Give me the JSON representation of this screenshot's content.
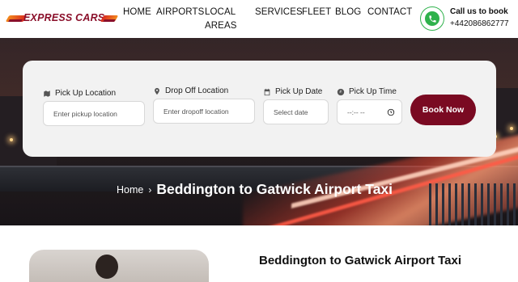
{
  "brand": {
    "logo_text": "EXPRESS CARS"
  },
  "nav": {
    "items": [
      "HOME",
      "AIRPORTS",
      "LOCAL AREAS",
      "SERVICES",
      "FLEET",
      "BLOG",
      "CONTACT"
    ]
  },
  "contact": {
    "call_label": "Call us to book",
    "phone": "+442086862777"
  },
  "booking": {
    "pickup_location": {
      "label": "Pick Up Location",
      "placeholder": "Enter pickup location"
    },
    "dropoff_location": {
      "label": "Drop Off Location",
      "placeholder": "Enter dropoff location"
    },
    "pickup_date": {
      "label": "Pick Up Date",
      "placeholder": "Select date"
    },
    "pickup_time": {
      "label": "Pick Up Time",
      "value": "--:-- --"
    },
    "submit_label": "Book Now"
  },
  "breadcrumb": {
    "home": "Home",
    "separator": "›",
    "current": "Beddington to Gatwick Airport Taxi"
  },
  "main": {
    "section_title": "Beddington to Gatwick Airport Taxi"
  },
  "colors": {
    "brand": "#7a0a22",
    "whatsapp": "#2fb24c",
    "card_bg": "#f2f2f2"
  },
  "icons": [
    "map-icon",
    "location-pin-icon",
    "calendar-icon",
    "clock-icon",
    "whatsapp-icon",
    "chevron-right-icon"
  ]
}
